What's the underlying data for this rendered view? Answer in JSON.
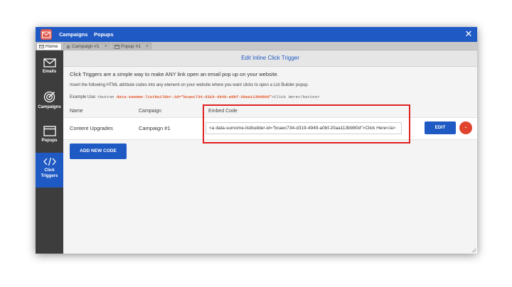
{
  "topbar": {
    "nav": [
      "Campaigns",
      "Popups"
    ],
    "close_glyph": "✕"
  },
  "tabs": [
    {
      "label": "Home",
      "icon": "mail-icon",
      "active": true
    },
    {
      "label": "Campaign #1",
      "icon": "globe-icon",
      "active": false,
      "close": "×"
    },
    {
      "label": "Popup #1",
      "icon": "window-icon",
      "active": false,
      "close": "×"
    }
  ],
  "sidebar": {
    "items": [
      {
        "label": "Emails",
        "icon": "envelope-icon"
      },
      {
        "label": "Campaigns",
        "icon": "target-icon"
      },
      {
        "label": "Popups",
        "icon": "window-icon"
      },
      {
        "label_line1": "Click",
        "label_line2": "Triggers",
        "icon": "code-icon",
        "active": true
      }
    ]
  },
  "main": {
    "header_title": "Edit Inline Click Trigger",
    "intro": "Click Triggers are a simple way to make ANY link open an email pop up on your website.",
    "intro2": "Insert the following HTML attribute codes into any element on your website where you want clicks to open a List Builder popup.",
    "example_label": "Example Use:",
    "example_code_start": "<button ",
    "example_code_attr": "data-sumome-listbuilder-id=\"bcaec734-d319-4949-a0bf-20aa113b980d\"",
    "example_code_end": ">Click Here</button>",
    "columns": {
      "name": "Name",
      "campaign": "Campaign",
      "embed": "Embed Code"
    },
    "rows": [
      {
        "name": "Content Upgrades",
        "campaign": "Campaign #1",
        "embed_code": "<a data-sumome-listbuilder-id=\"bcaec734-d319-4949-a0bf-20aa113b980d\">Click Here</a>",
        "edit_label": "EDIT",
        "delete_label": "-"
      }
    ],
    "add_button": "ADD NEW CODE"
  },
  "colors": {
    "brand_blue": "#1f59c4",
    "sidebar_dark": "#3d3d3d",
    "delete_red": "#e0442e",
    "highlight_red": "#e02020",
    "code_orange": "#e2572b"
  }
}
